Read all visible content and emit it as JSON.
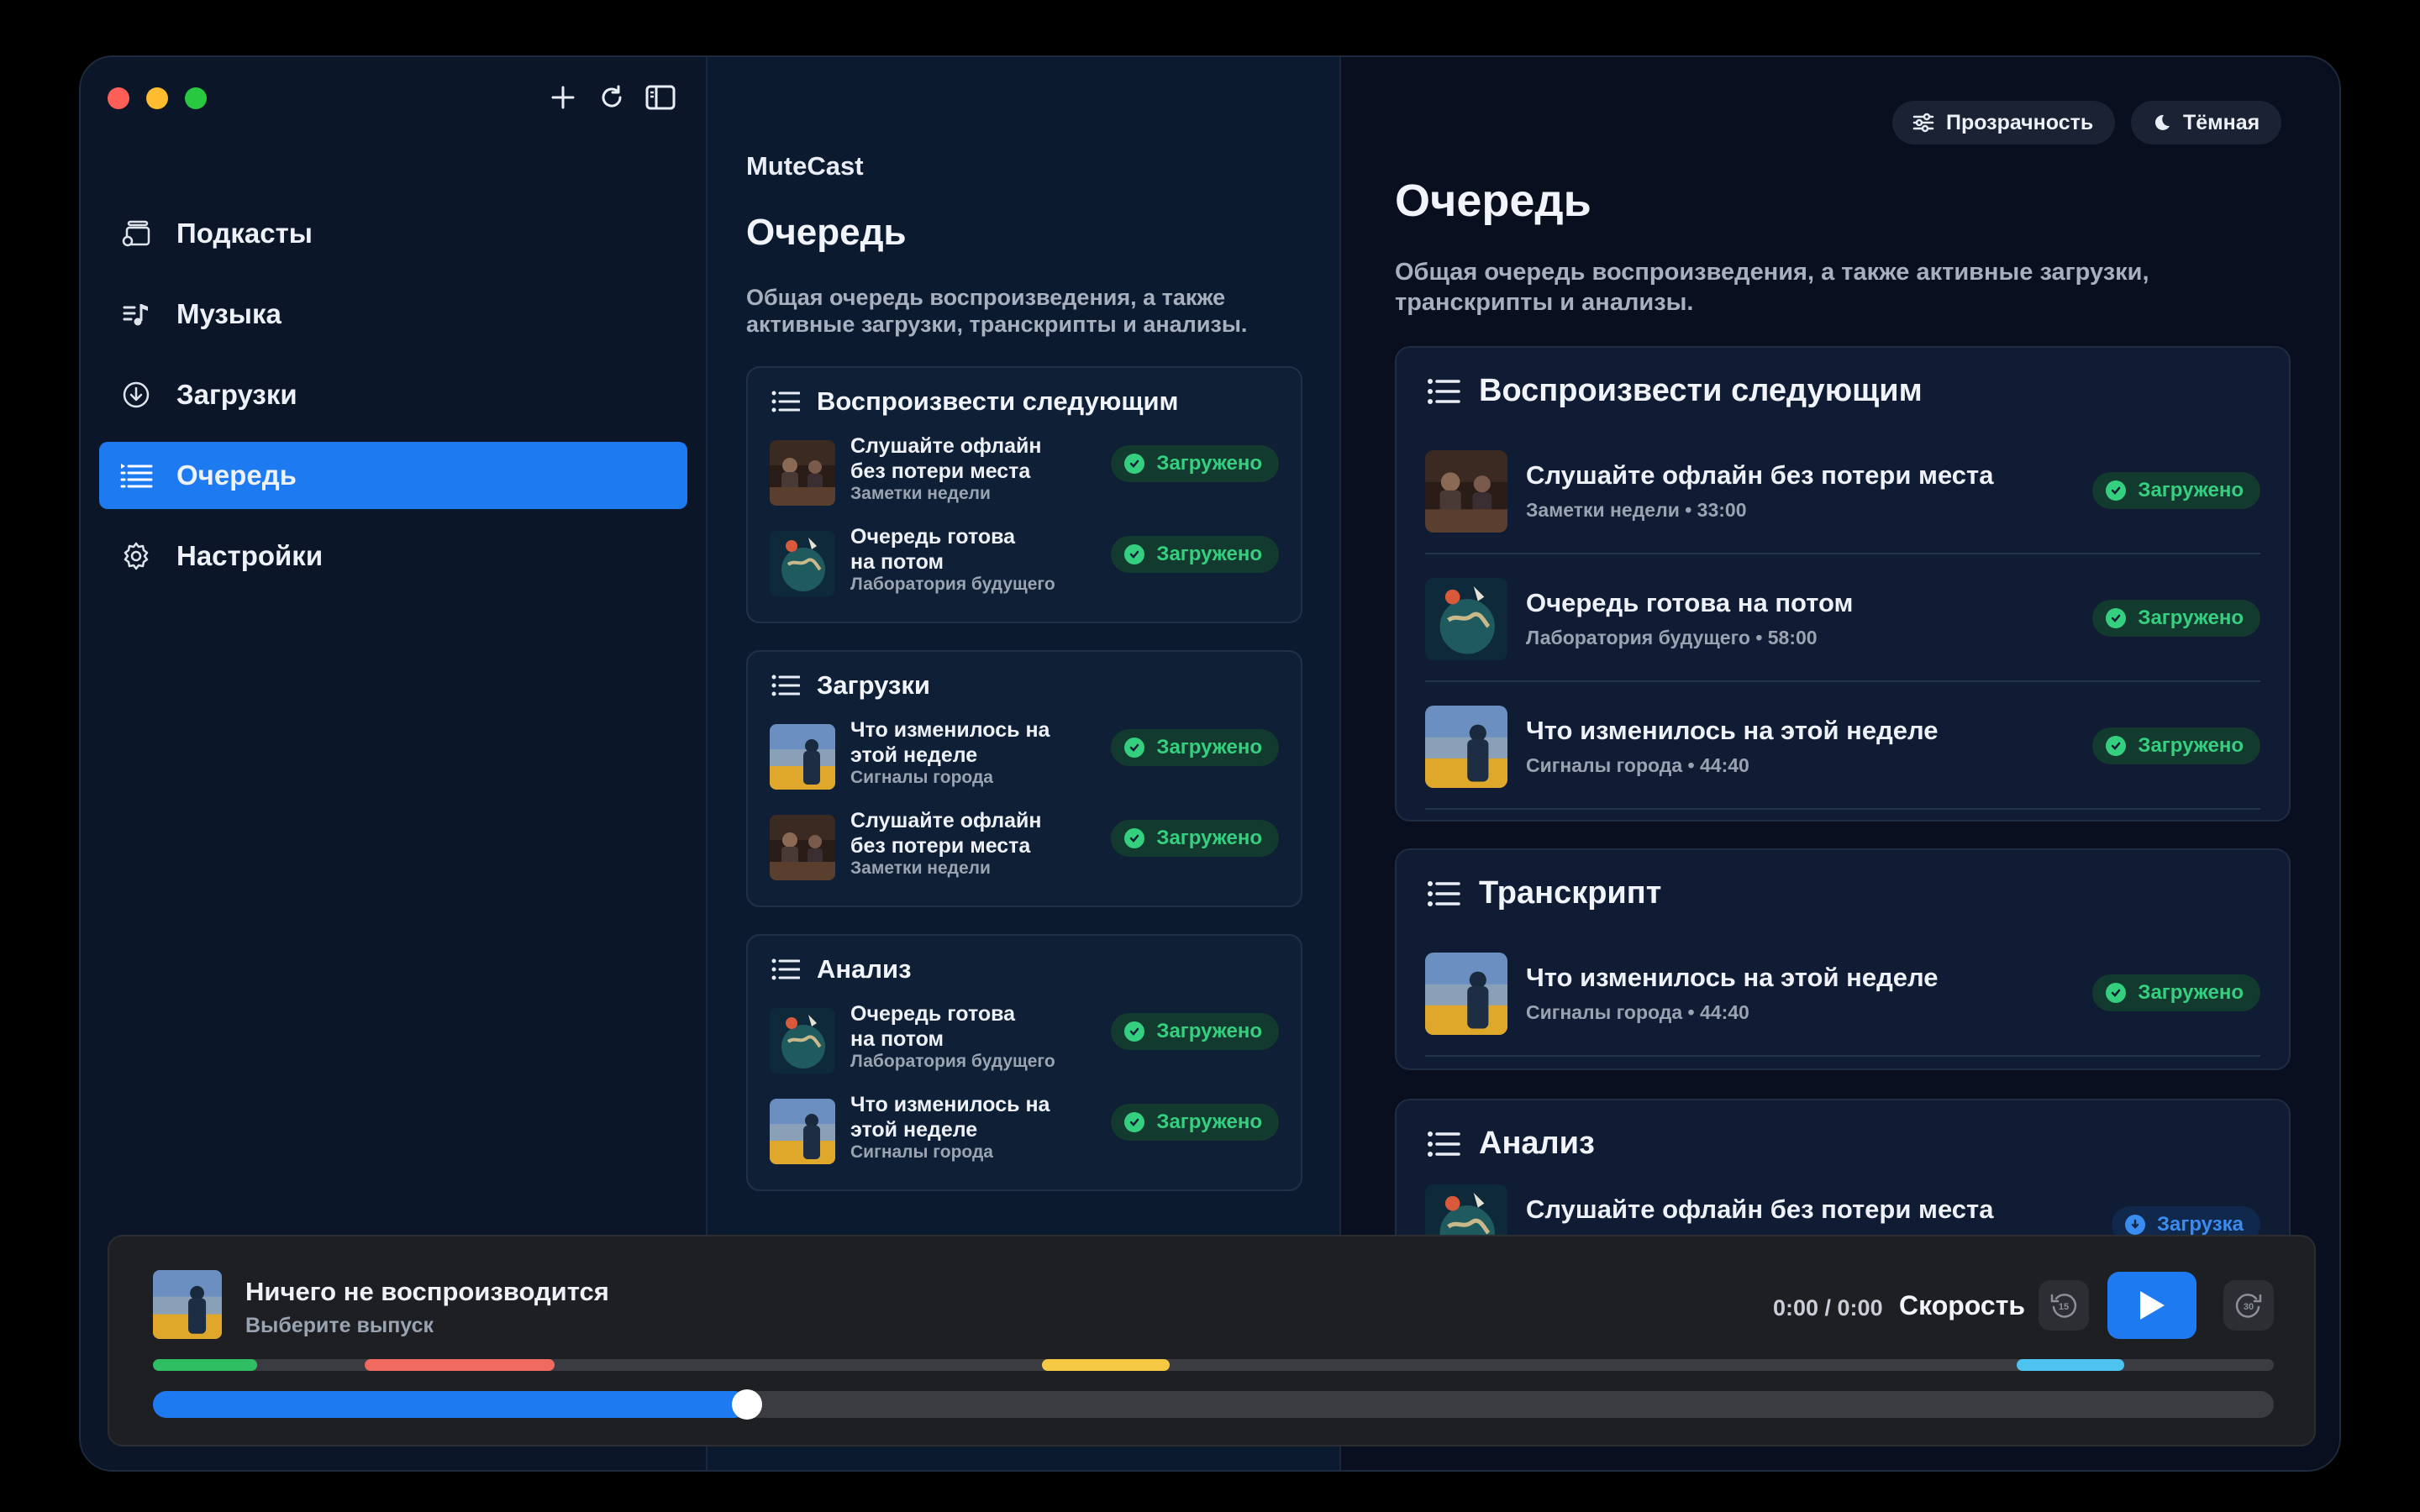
{
  "app": {
    "name": "MuteCast"
  },
  "sidebar": {
    "items": [
      {
        "label": "Подкасты",
        "icon": "podcasts-icon"
      },
      {
        "label": "Музыка",
        "icon": "music-icon"
      },
      {
        "label": "Загрузки",
        "icon": "download-icon"
      },
      {
        "label": "Очередь",
        "icon": "queue-icon",
        "active": true
      },
      {
        "label": "Настройки",
        "icon": "gear-icon"
      }
    ]
  },
  "middle": {
    "title": "Очередь",
    "subtitle": "Общая очередь воспроизведения, а также активные загрузки, транскрипты и анализы.",
    "cards": [
      {
        "title": "Воспроизвести следующим",
        "rows": [
          {
            "line1": "Слушайте офлайн",
            "line2": "без потери места",
            "sub": "Заметки недели",
            "status": "Загружено"
          },
          {
            "line1": "Очередь готова",
            "line2": "на потом",
            "sub": "Лаборатория будущего",
            "status": "Загружено"
          }
        ]
      },
      {
        "title": "Загрузки",
        "rows": [
          {
            "line1": "Что изменилось на",
            "line2": "этой неделе",
            "sub": "Сигналы города",
            "status": "Загружено"
          },
          {
            "line1": "Слушайте офлайн",
            "line2": "без потери места",
            "sub": "Заметки недели",
            "status": "Загружено"
          }
        ]
      },
      {
        "title": "Анализ",
        "rows": [
          {
            "line1": "Очередь готова",
            "line2": "на потом",
            "sub": "Лаборатория будущего",
            "status": "Загружено"
          },
          {
            "line1": "Что изменилось на",
            "line2": "этой неделе",
            "sub": "Сигналы города",
            "status": "Загружено"
          }
        ]
      }
    ]
  },
  "right": {
    "transparency_label": "Прозрачность",
    "theme_label": "Тёмная",
    "title": "Очередь",
    "subtitle": "Общая очередь воспроизведения, а также активные загрузки, транскрипты и анализы.",
    "cards": [
      {
        "title": "Воспроизвести следующим",
        "rows": [
          {
            "title": "Слушайте офлайн без потери места",
            "sub": "Заметки недели • 33:00",
            "status": "Загружено"
          },
          {
            "title": "Очередь готова на потом",
            "sub": "Лаборатория будущего • 58:00",
            "status": "Загружено"
          },
          {
            "title": "Что изменилось на этой неделе",
            "sub": "Сигналы города • 44:40",
            "status": "Загружено"
          }
        ]
      },
      {
        "title": "Транскрипт",
        "rows": [
          {
            "title": "Что изменилось на этой неделе",
            "sub": "Сигналы города • 44:40",
            "status": "Загружено"
          }
        ]
      },
      {
        "title": "Анализ",
        "rows": [
          {
            "title": "Слушайте офлайн без потери места",
            "sub": "",
            "status": "Загрузка"
          }
        ]
      }
    ]
  },
  "player": {
    "title": "Ничего не воспроизводится",
    "subtitle": "Выберите выпуск",
    "time": "0:00 / 0:00",
    "speed_label": "Скорость",
    "skip_back": "15",
    "skip_forward": "30",
    "progress_fraction": 0.28,
    "chapter_colors": [
      "#2fbf62",
      "#f06a5f",
      "#f6c945",
      "#4cc4ef"
    ]
  },
  "colors": {
    "accent": "#1e7af0",
    "success": "#35d07f"
  }
}
